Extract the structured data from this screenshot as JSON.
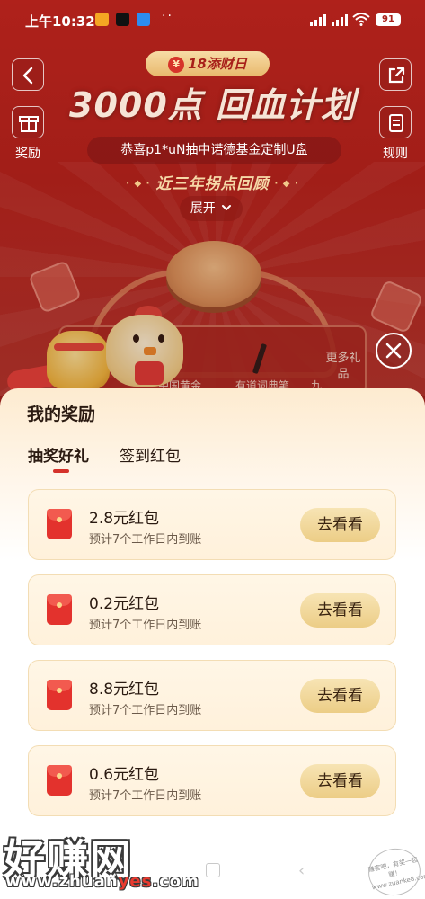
{
  "status_bar": {
    "time": "上午10:32",
    "battery": "91",
    "dots": "··"
  },
  "header": {
    "back_label": "",
    "share_label": "",
    "reward_label": "奖励",
    "rules_label": "规则",
    "pill_prefix": "¥",
    "pill_text": "18添财日",
    "main_title": "3000点 回血计划",
    "subtitle": "恭喜p1*uN抽中诺德基金定制U盘",
    "review_label": "近三年拐点回顾",
    "expand_label": "展开"
  },
  "prize_strip": {
    "items": [
      "中国黄金",
      "有道词典笔",
      "九"
    ],
    "more_label": "更多礼品"
  },
  "sheet": {
    "title": "我的奖励",
    "tabs": [
      {
        "label": "抽奖好礼",
        "active": true
      },
      {
        "label": "签到红包",
        "active": false
      }
    ],
    "rewards": [
      {
        "amount": "2.8元红包",
        "note": "预计7个工作日内到账",
        "action": "去看看"
      },
      {
        "amount": "0.2元红包",
        "note": "预计7个工作日内到账",
        "action": "去看看"
      },
      {
        "amount": "8.8元红包",
        "note": "预计7个工作日内到账",
        "action": "去看看"
      },
      {
        "amount": "0.6元红包",
        "note": "预计7个工作日内到账",
        "action": "去看看"
      }
    ]
  },
  "watermark": {
    "logo": "好赚网",
    "url_prefix": "www.zhuan",
    "url_highlight": "yes",
    "url_suffix": ".com",
    "stamp": "赚客吧，有奖一起赚！www.zuanke8.com"
  },
  "colors": {
    "brand_red": "#c8261f",
    "button_gold": "#eccd86",
    "envelope_red": "#e3322d"
  }
}
